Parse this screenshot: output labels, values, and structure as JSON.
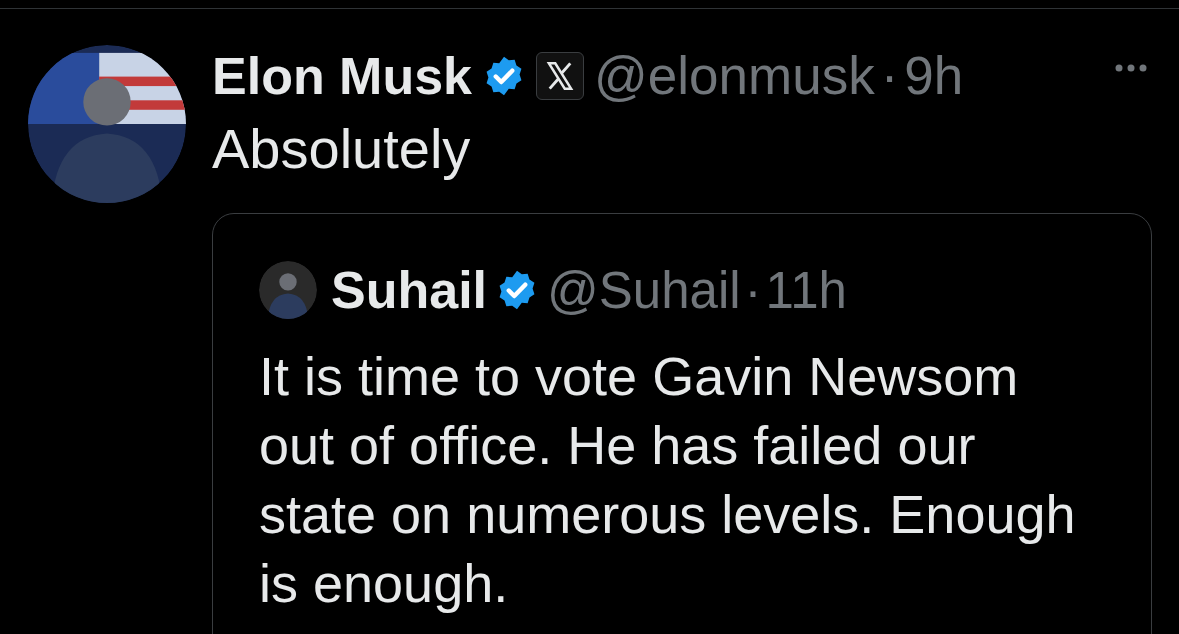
{
  "tweet": {
    "author": {
      "name": "Elon Musk",
      "verified": true,
      "affiliate": true,
      "handle": "@elonmusk",
      "separator": "·",
      "time": "9h"
    },
    "text": "Absolutely",
    "quote": {
      "author": {
        "name": "Suhail",
        "verified": true,
        "affiliate": false,
        "handle": "@Suhail",
        "separator": "·",
        "time": "11h"
      },
      "text": "It is time to vote Gavin Newsom out of office. He has failed our state on numerous levels. Enough is enough."
    }
  }
}
